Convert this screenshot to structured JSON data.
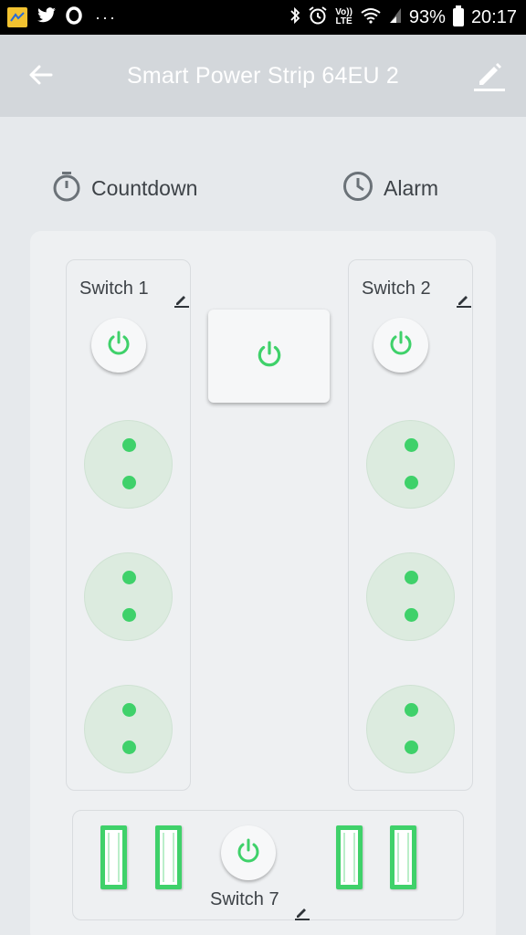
{
  "status_bar": {
    "battery": "93%",
    "time": "20:17",
    "volte_top": "Vo))",
    "volte_bottom": "LTE",
    "dots": "···"
  },
  "header": {
    "title": "Smart Power Strip 64EU 2",
    "back_icon": "arrow-left-icon",
    "edit_icon": "pencil-icon"
  },
  "timers": {
    "countdown_label": "Countdown",
    "alarm_label": "Alarm"
  },
  "switches": {
    "left": {
      "label": "Switch 1",
      "sockets": 3,
      "state": "on"
    },
    "right": {
      "label": "Switch 2",
      "sockets": 3,
      "state": "on"
    },
    "usb": {
      "label": "Switch 7",
      "ports": 4,
      "state": "on"
    }
  },
  "colors": {
    "accent_green": "#3fd16a",
    "socket_bg": "#dcebdf",
    "appbar_bg": "#d3d7db",
    "page_bg": "#e6e9ec"
  }
}
